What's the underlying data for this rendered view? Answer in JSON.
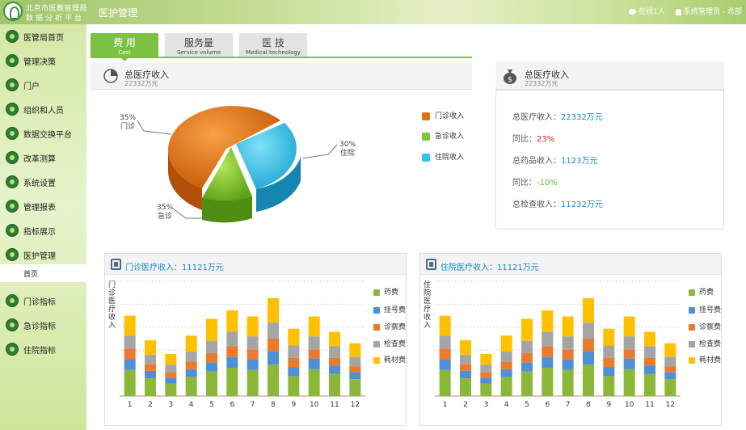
{
  "header": {
    "logo_line1": "北京市医教管理局",
    "logo_line2": "数据分析平台",
    "title": "医护管理",
    "online": "在线1人",
    "user": "系统管理员 - 总部"
  },
  "sidebar": {
    "items": [
      {
        "label": "医管局首页"
      },
      {
        "label": "管理决策"
      },
      {
        "label": "门户"
      },
      {
        "label": "组织和人员"
      },
      {
        "label": "数据交换平台"
      },
      {
        "label": "改革测算"
      },
      {
        "label": "系统设置"
      },
      {
        "label": "管理报表"
      },
      {
        "label": "指标展示"
      },
      {
        "label": "医护管理"
      }
    ],
    "sub_item": "首页",
    "items_after": [
      {
        "label": "门诊指标"
      },
      {
        "label": "急诊指标"
      },
      {
        "label": "住院指标"
      }
    ]
  },
  "tabs": [
    {
      "label": "费 用",
      "sub": "Cost",
      "active": true
    },
    {
      "label": "服务量",
      "sub": "Service volume",
      "active": false
    },
    {
      "label": "医 技",
      "sub": "Medical technology",
      "active": false
    }
  ],
  "pie_panel": {
    "title": "总医疗收入",
    "subtitle": "22332万元",
    "labels": [
      {
        "pct": "35%",
        "name": "门诊"
      },
      {
        "pct": "30%",
        "name": "住院"
      },
      {
        "pct": "35%",
        "name": "急诊"
      }
    ],
    "legend": [
      "门诊收入",
      "急诊收入",
      "住院收入"
    ]
  },
  "info_panel": {
    "title": "总医疗收入",
    "subtitle": "22332万元",
    "rows": [
      {
        "label": "总医疗收入：",
        "value": "22332万元"
      },
      {
        "label": "同比：",
        "value": "23%"
      },
      {
        "label": "总药品收入：",
        "value": "1123万元"
      },
      {
        "label": "同比：",
        "value": "-10%"
      },
      {
        "label": "总检查收入：",
        "value": "11232万元"
      }
    ]
  },
  "bar_panels": [
    {
      "title": "门诊医疗收入：11121万元",
      "ylabel": "门诊医疗收入"
    },
    {
      "title": "住院医疗收入：11121万元",
      "ylabel": "住院医疗收入"
    }
  ],
  "colors": {
    "green": "#8cb83a",
    "blue": "#4f8fd6",
    "orange": "#ec7a2d",
    "gray": "#a5a5a5",
    "yellow": "#ffc000",
    "accent": "#7cc242"
  },
  "chart_data": [
    {
      "type": "pie",
      "categories": [
        "门诊收入",
        "急诊收入",
        "住院收入"
      ],
      "values": [
        35,
        35,
        30
      ]
    },
    {
      "type": "bar",
      "stacked": true,
      "categories": [
        "1",
        "2",
        "3",
        "4",
        "5",
        "6",
        "7",
        "8",
        "9",
        "10",
        "11",
        "12"
      ],
      "series": [
        {
          "name": "药费",
          "values": [
            34,
            23,
            16,
            25,
            32,
            37,
            34,
            41,
            26,
            35,
            29,
            22
          ]
        },
        {
          "name": "挂号费",
          "values": [
            14,
            10,
            8,
            10,
            12,
            14,
            14,
            18,
            12,
            14,
            11,
            9
          ]
        },
        {
          "name": "诊察费",
          "values": [
            14,
            9,
            7,
            10,
            12,
            14,
            13,
            16,
            12,
            12,
            10,
            8
          ]
        },
        {
          "name": "检查费",
          "values": [
            17,
            12,
            10,
            13,
            16,
            19,
            17,
            21,
            16,
            17,
            15,
            12
          ]
        },
        {
          "name": "耗材费",
          "values": [
            26,
            19,
            14,
            21,
            29,
            28,
            26,
            32,
            22,
            26,
            19,
            18
          ]
        }
      ],
      "grid": true
    },
    {
      "type": "bar",
      "stacked": true,
      "categories": [
        "1",
        "2",
        "3",
        "4",
        "5",
        "6",
        "7",
        "8",
        "9",
        "10",
        "11",
        "12"
      ],
      "series": [
        {
          "name": "药费",
          "values": [
            34,
            23,
            16,
            25,
            32,
            37,
            34,
            41,
            26,
            35,
            29,
            22
          ]
        },
        {
          "name": "挂号费",
          "values": [
            14,
            10,
            8,
            10,
            12,
            14,
            14,
            18,
            12,
            14,
            11,
            9
          ]
        },
        {
          "name": "诊察费",
          "values": [
            14,
            9,
            7,
            10,
            12,
            14,
            13,
            16,
            12,
            12,
            10,
            8
          ]
        },
        {
          "name": "检查费",
          "values": [
            17,
            12,
            10,
            13,
            16,
            19,
            17,
            21,
            16,
            17,
            15,
            12
          ]
        },
        {
          "name": "耗材费",
          "values": [
            26,
            19,
            14,
            21,
            29,
            28,
            26,
            32,
            22,
            26,
            19,
            18
          ]
        }
      ],
      "grid": true
    }
  ]
}
